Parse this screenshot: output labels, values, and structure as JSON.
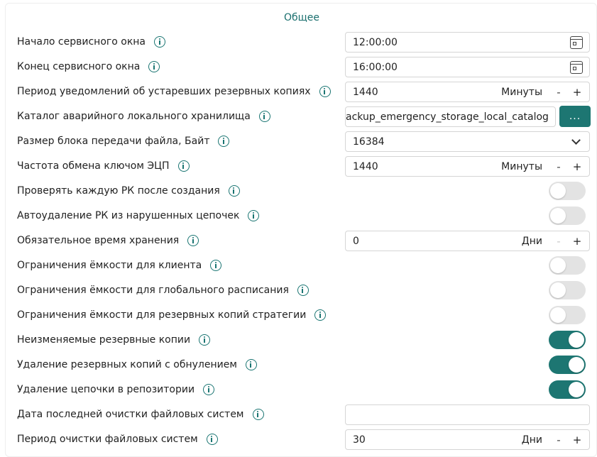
{
  "section_title": "Общее",
  "colors": {
    "accent": "#1d7672",
    "toggle_off": "#e3e3e3",
    "title": "#1a6f6e"
  },
  "rows": [
    {
      "label": "Начало сервисного окна",
      "control": "time",
      "value": "12:00:00",
      "icon": "calendar-icon"
    },
    {
      "label": "Конец сервисного окна",
      "control": "time",
      "value": "16:00:00",
      "icon": "calendar-icon"
    },
    {
      "label": "Период уведомлений об устаревших резервных копиях",
      "control": "number",
      "value": "1440",
      "unit": "Минуты",
      "minus": "-",
      "plus": "+"
    },
    {
      "label": "Каталог аварийного локального хранилища",
      "control": "path",
      "value": "ackup_emergency_storage_local_catalog",
      "button": "..."
    },
    {
      "label": "Размер блока передачи файла, Байт",
      "control": "select",
      "value": "16384",
      "icon": "chevron-down-icon"
    },
    {
      "label": "Частота обмена ключом ЭЦП",
      "control": "number",
      "value": "1440",
      "unit": "Минуты",
      "minus": "-",
      "plus": "+"
    },
    {
      "label": "Проверять каждую РК после создания",
      "control": "toggle",
      "on": false
    },
    {
      "label": "Автоудаление РК из нарушенных цепочек",
      "control": "toggle",
      "on": false
    },
    {
      "label": "Обязательное время хранения",
      "control": "number",
      "value": "0",
      "unit": "Дни",
      "minus": "-",
      "plus": "+",
      "minus_disabled": true
    },
    {
      "label": "Ограничения ёмкости для клиента",
      "control": "toggle",
      "on": false
    },
    {
      "label": "Ограничения ёмкости для глобального расписания",
      "control": "toggle",
      "on": false
    },
    {
      "label": "Ограничения ёмкости для резервных копий стратегии",
      "control": "toggle",
      "on": false
    },
    {
      "label": "Неизменяемые резервные копии",
      "control": "toggle",
      "on": true
    },
    {
      "label": "Удаление резервных копий с обнулением",
      "control": "toggle",
      "on": true
    },
    {
      "label": "Удаление цепочки в репозитории",
      "control": "toggle",
      "on": true
    },
    {
      "label": "Дата последней очистки файловых систем",
      "control": "empty",
      "value": ""
    },
    {
      "label": "Период очистки файловых систем",
      "control": "number",
      "value": "30",
      "unit": "Дни",
      "minus": "-",
      "plus": "+"
    }
  ]
}
